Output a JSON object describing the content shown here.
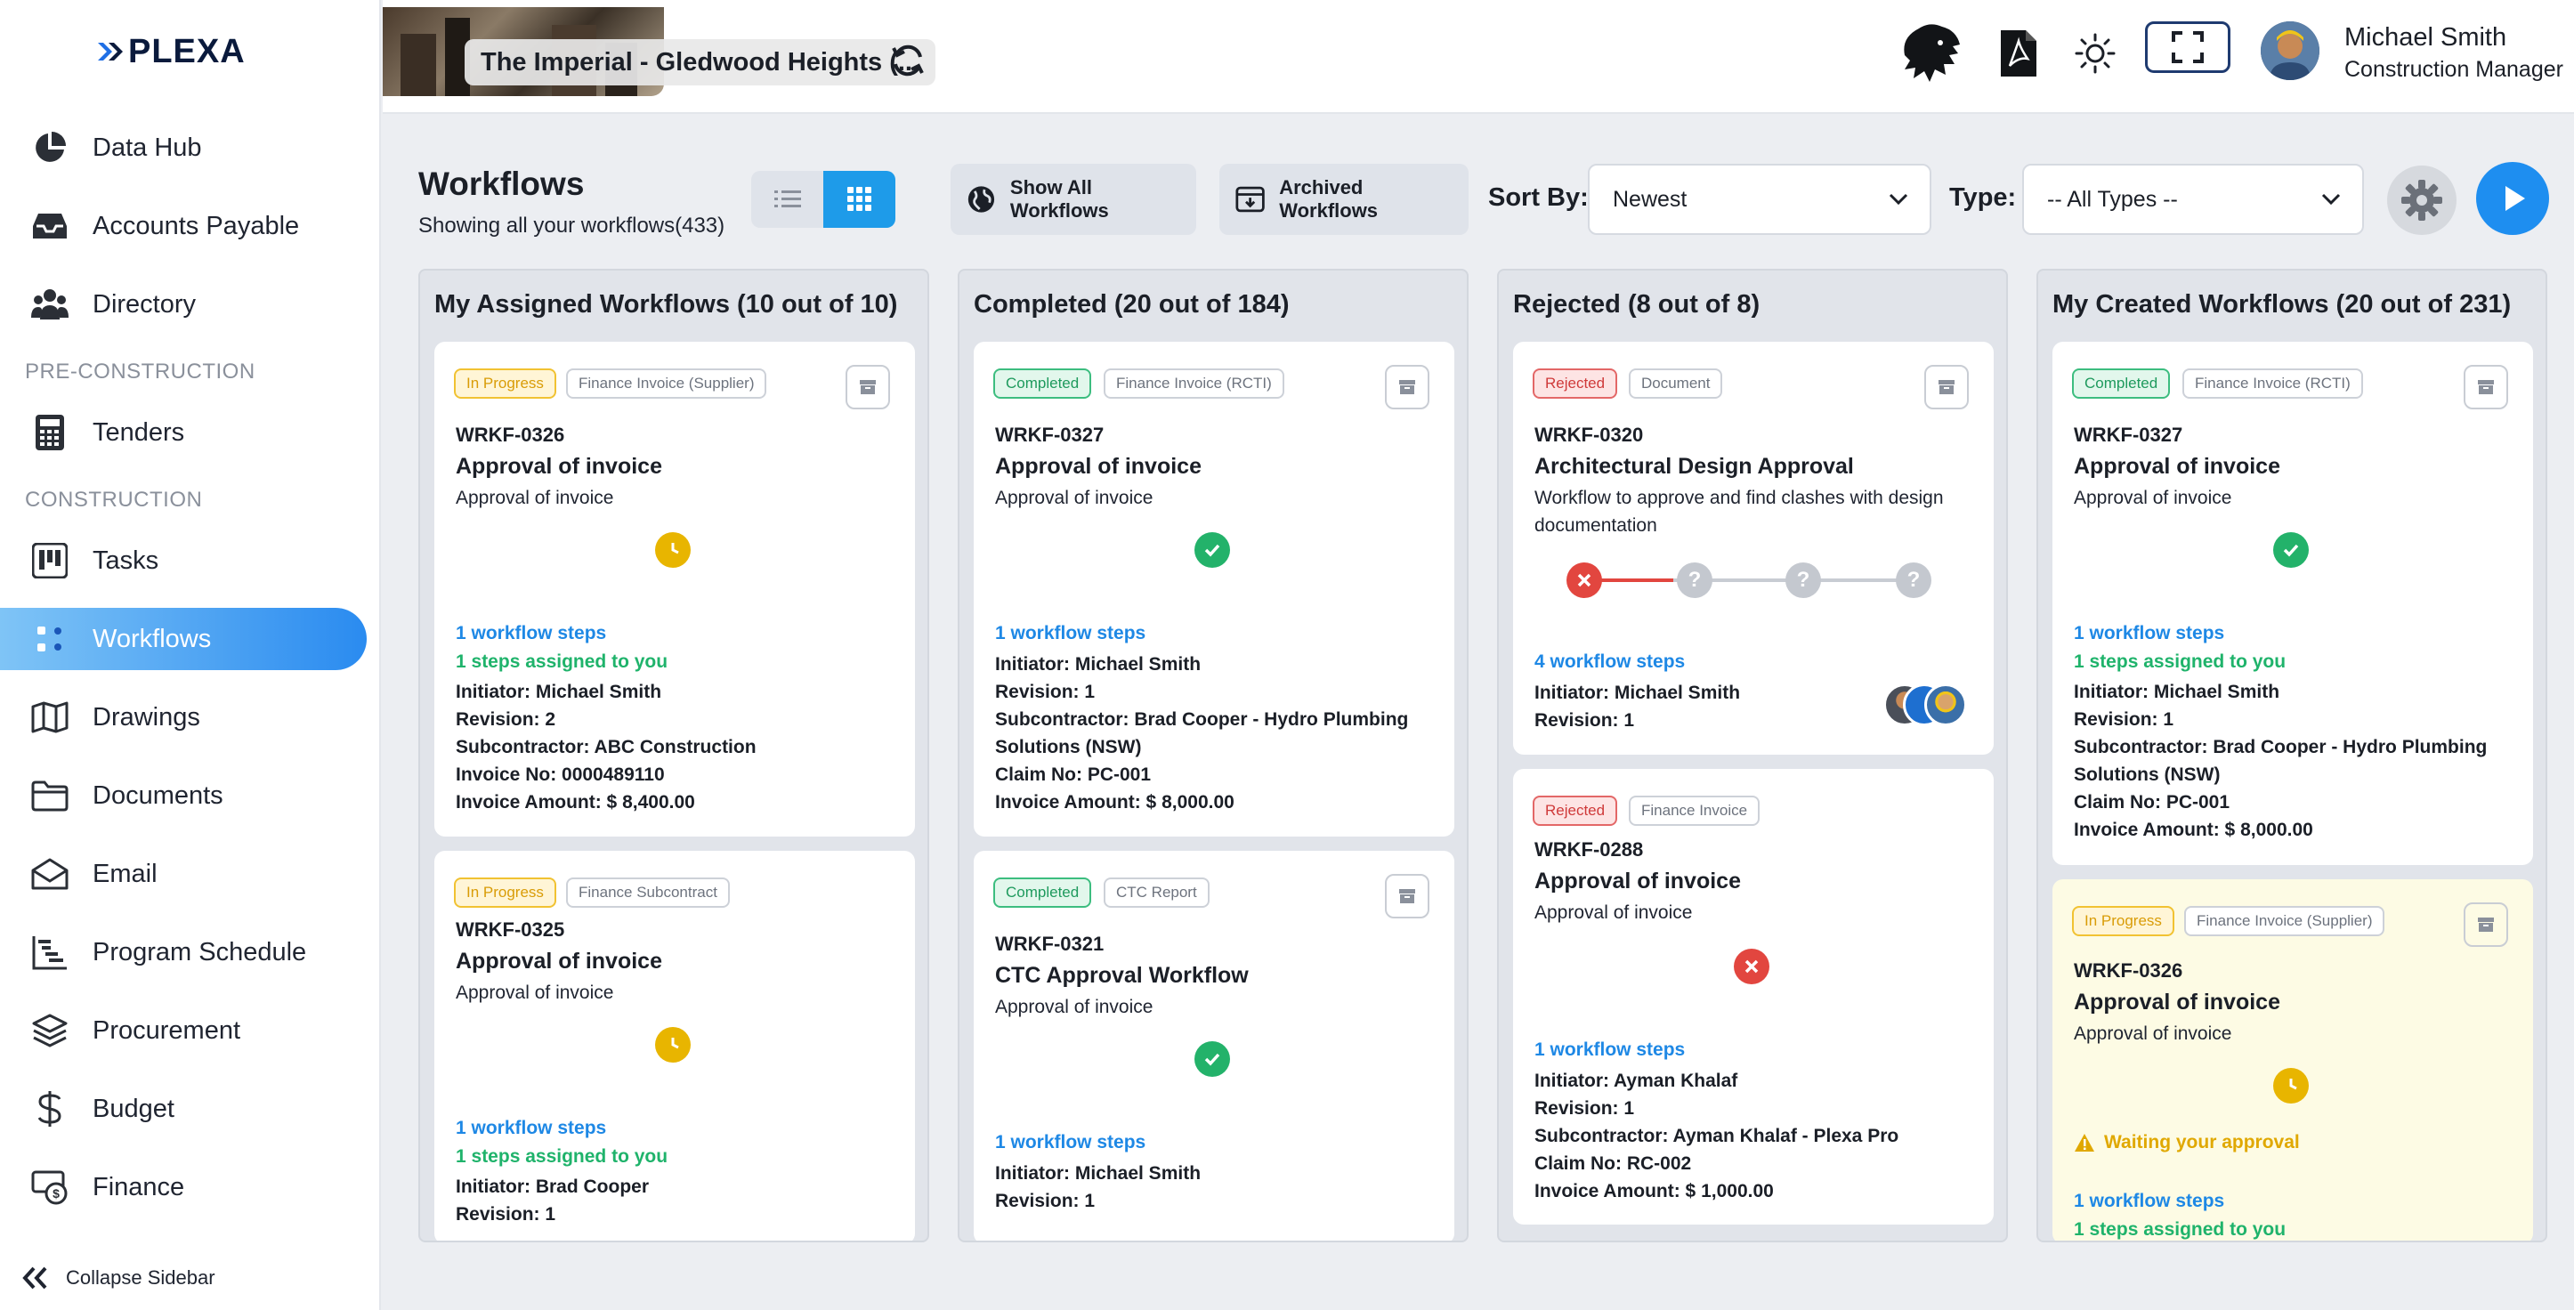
{
  "app": {
    "brand": "PLEXA"
  },
  "sidebar": {
    "items_top": [
      {
        "label": "Data Hub",
        "icon": "pie-chart-icon"
      },
      {
        "label": "Accounts Payable",
        "icon": "inbox-tray-icon"
      },
      {
        "label": "Directory",
        "icon": "people-icon"
      }
    ],
    "section_preconstruction": "PRE-CONSTRUCTION",
    "tenders": "Tenders",
    "section_construction": "CONSTRUCTION",
    "items_construction": [
      {
        "label": "Tasks",
        "icon": "kanban-board-icon"
      },
      {
        "label": "Workflows",
        "icon": "workflow-icon",
        "active": true
      },
      {
        "label": "Drawings",
        "icon": "map-icon"
      },
      {
        "label": "Documents",
        "icon": "folder-icon"
      },
      {
        "label": "Email",
        "icon": "envelope-icon"
      },
      {
        "label": "Program Schedule",
        "icon": "gantt-icon"
      },
      {
        "label": "Procurement",
        "icon": "layers-icon"
      },
      {
        "label": "Budget",
        "icon": "dollar-icon"
      },
      {
        "label": "Finance",
        "icon": "money-icon"
      }
    ],
    "collapse_label": "Collapse Sidebar",
    "active_color": "#2a8bf0"
  },
  "topbar": {
    "project_name": "The Imperial - Gledwood Heights (...",
    "user_name": "Michael Smith",
    "user_role": "Construction Manager",
    "icons": [
      "refresh-icon",
      "lion-logo-icon",
      "pdf-icon",
      "brightness-icon",
      "fullscreen-icon",
      "avatar"
    ]
  },
  "page": {
    "title": "Workflows",
    "subtitle": "Showing all your workflows(433)",
    "show_all_label": "Show All Workflows",
    "archived_label": "Archived Workflows",
    "sort_label": "Sort By:",
    "sort_value": "Newest",
    "type_label": "Type:",
    "type_value": "-- All Types --"
  },
  "columns": [
    {
      "title": "My Assigned Workflows (10 out of 10)",
      "cards": [
        {
          "status": "In Progress",
          "type": "Finance Invoice (Supplier)",
          "id": "WRKF-0326",
          "name": "Approval of invoice",
          "desc": "Approval of invoice",
          "steps": "1 workflow steps",
          "assigned": "1 steps assigned to you",
          "initiator": "Initiator: Michael Smith",
          "revision": "Revision:  2",
          "subcontractor": "Subcontractor: ABC Construction",
          "ref": "Invoice No: 0000489110",
          "amount": "Invoice Amount: $ 8,400.00"
        },
        {
          "status": "In Progress",
          "type": "Finance Subcontract",
          "id": "WRKF-0325",
          "name": "Approval of invoice",
          "desc": "Approval of invoice",
          "steps": "1 workflow steps",
          "assigned": "1 steps assigned to you",
          "initiator": "Initiator: Brad Cooper",
          "revision": "Revision:  1"
        }
      ]
    },
    {
      "title": "Completed (20 out of 184)",
      "cards": [
        {
          "status": "Completed",
          "type": "Finance Invoice (RCTI)",
          "id": "WRKF-0327",
          "name": "Approval of invoice",
          "desc": "Approval of invoice",
          "steps": "1 workflow steps",
          "initiator": "Initiator: Michael Smith",
          "revision": "Revision:  1",
          "subcontractor": "Subcontractor: Brad Cooper - Hydro Plumbing Solutions (NSW)",
          "ref": "Claim No: PC-001",
          "amount": "Invoice Amount: $ 8,000.00"
        },
        {
          "status": "Completed",
          "type": "CTC Report",
          "id": "WRKF-0321",
          "name": "CTC Approval Workflow",
          "desc": "Approval of invoice",
          "steps": "1 workflow steps",
          "initiator": "Initiator: Michael Smith",
          "revision": "Revision:  1"
        }
      ]
    },
    {
      "title": "Rejected (8 out of 8)",
      "cards": [
        {
          "status": "Rejected",
          "type": "Document",
          "id": "WRKF-0320",
          "name": "Architectural Design Approval",
          "desc": "Workflow to approve and find clashes with design documentation",
          "steps": "4 workflow steps",
          "initiator": "Initiator: Michael Smith",
          "revision": "Revision:  1",
          "stepper": [
            "rejected",
            "pending",
            "pending",
            "pending"
          ]
        },
        {
          "status": "Rejected",
          "type": "Finance Invoice",
          "id": "WRKF-0288",
          "name": "Approval of invoice",
          "desc": "Approval of invoice",
          "steps": "1 workflow steps",
          "initiator": "Initiator: Ayman Khalaf",
          "revision": "Revision:  1",
          "subcontractor": "Subcontractor: Ayman Khalaf - Plexa Pro",
          "ref": "Claim No: RC-002",
          "amount": "Invoice Amount: $ 1,000.00"
        }
      ]
    },
    {
      "title": "My Created Workflows (20 out of 231)",
      "cards": [
        {
          "status": "Completed",
          "type": "Finance Invoice (RCTI)",
          "id": "WRKF-0327",
          "name": "Approval of invoice",
          "desc": "Approval of invoice",
          "steps": "1 workflow steps",
          "assigned": "1 steps assigned to you",
          "initiator": "Initiator: Michael Smith",
          "revision": "Revision:  1",
          "subcontractor": "Subcontractor: Brad Cooper - Hydro Plumbing Solutions (NSW)",
          "ref": "Claim No: PC-001",
          "amount": "Invoice Amount: $ 8,000.00"
        },
        {
          "status": "In Progress",
          "type": "Finance Invoice (Supplier)",
          "id": "WRKF-0326",
          "name": "Approval of invoice",
          "desc": "Approval of invoice",
          "waiting": "Waiting your approval",
          "steps": "1 workflow steps",
          "assigned": "1 steps assigned to you"
        }
      ]
    }
  ],
  "colors": {
    "accent": "#1e8ef0",
    "in_progress": "#e8b500",
    "completed": "#23b26a",
    "rejected": "#e2463f",
    "link": "#1e88e5"
  }
}
